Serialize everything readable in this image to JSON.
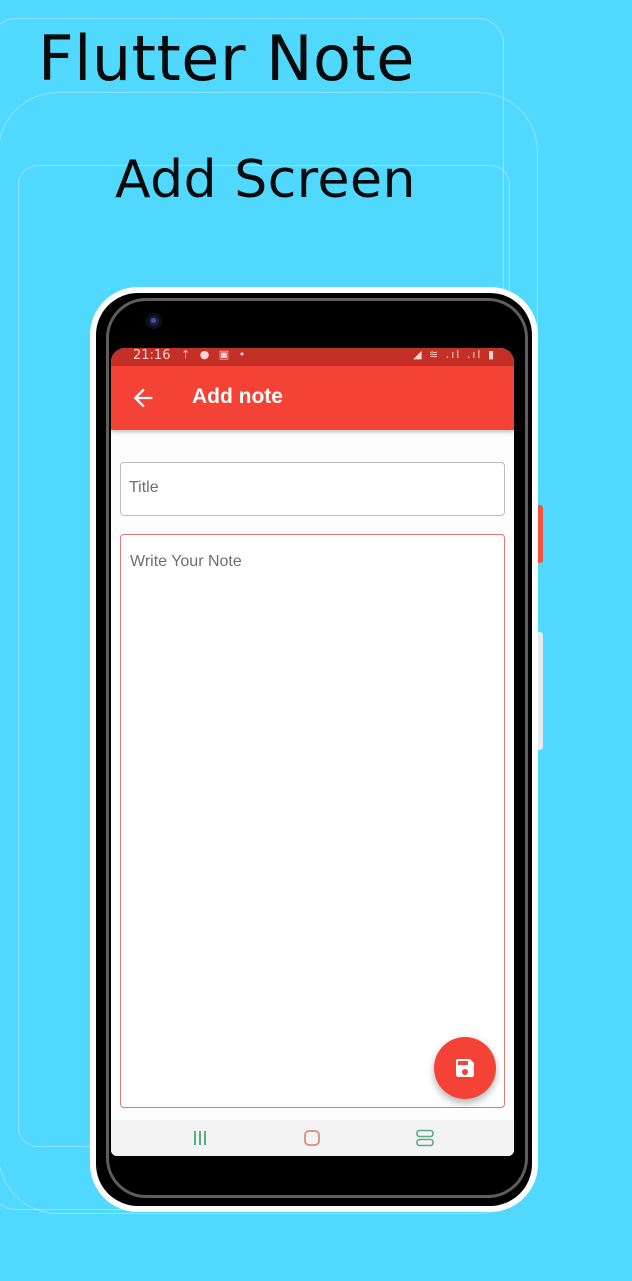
{
  "promo": {
    "headline": "Flutter Note",
    "subheadline": "Add Screen"
  },
  "statusbar": {
    "time": "21:16",
    "left_icons": "⇡ ● ▣ •",
    "right_icons": "◢ ≋ .ıl .ıl ▮"
  },
  "appbar": {
    "title": "Add note",
    "back_icon": "arrow-back-icon"
  },
  "form": {
    "title_placeholder": "Title",
    "title_value": "",
    "note_placeholder": "Write Your Note",
    "note_value": ""
  },
  "fab": {
    "icon": "save-icon"
  },
  "navbar": {
    "buttons": [
      "recents",
      "home",
      "back"
    ]
  },
  "colors": {
    "background": "#51d8ff",
    "primary": "#f44336",
    "statusbar": "#c42f26",
    "nav_icons": "#5aaa86"
  }
}
